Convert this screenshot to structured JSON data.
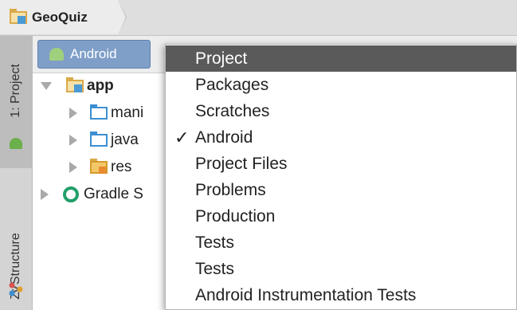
{
  "breadcrumb": {
    "project_name": "GeoQuiz"
  },
  "tool_strip": {
    "project_tab": "1: Project",
    "structure_tab": "Z: Structure"
  },
  "project_panel": {
    "view_selector_label": "Android",
    "tree": [
      {
        "label": "app",
        "expanded": true
      },
      {
        "label": "manifests",
        "visible_text": "mani"
      },
      {
        "label": "java"
      },
      {
        "label": "res"
      },
      {
        "label": "Gradle Scripts",
        "visible_text": "Gradle S"
      }
    ]
  },
  "view_menu": {
    "items": [
      {
        "label": "Project",
        "selected": true,
        "checked": false
      },
      {
        "label": "Packages",
        "selected": false,
        "checked": false
      },
      {
        "label": "Scratches",
        "selected": false,
        "checked": false
      },
      {
        "label": "Android",
        "selected": false,
        "checked": true
      },
      {
        "label": "Project Files",
        "selected": false,
        "checked": false
      },
      {
        "label": "Problems",
        "selected": false,
        "checked": false
      },
      {
        "label": "Production",
        "selected": false,
        "checked": false
      },
      {
        "label": "Tests",
        "selected": false,
        "checked": false
      },
      {
        "label": "Tests",
        "selected": false,
        "checked": false
      },
      {
        "label": "Android Instrumentation Tests",
        "selected": false,
        "checked": false
      }
    ],
    "check_glyph": "✓"
  },
  "colors": {
    "menu_selected_bg": "#5a5a5a",
    "view_selector_bg": "#7f9fc8",
    "folder_blue": "#3d8fd1",
    "folder_yellow": "#d9a94a",
    "gradle_green": "#22a06b"
  }
}
